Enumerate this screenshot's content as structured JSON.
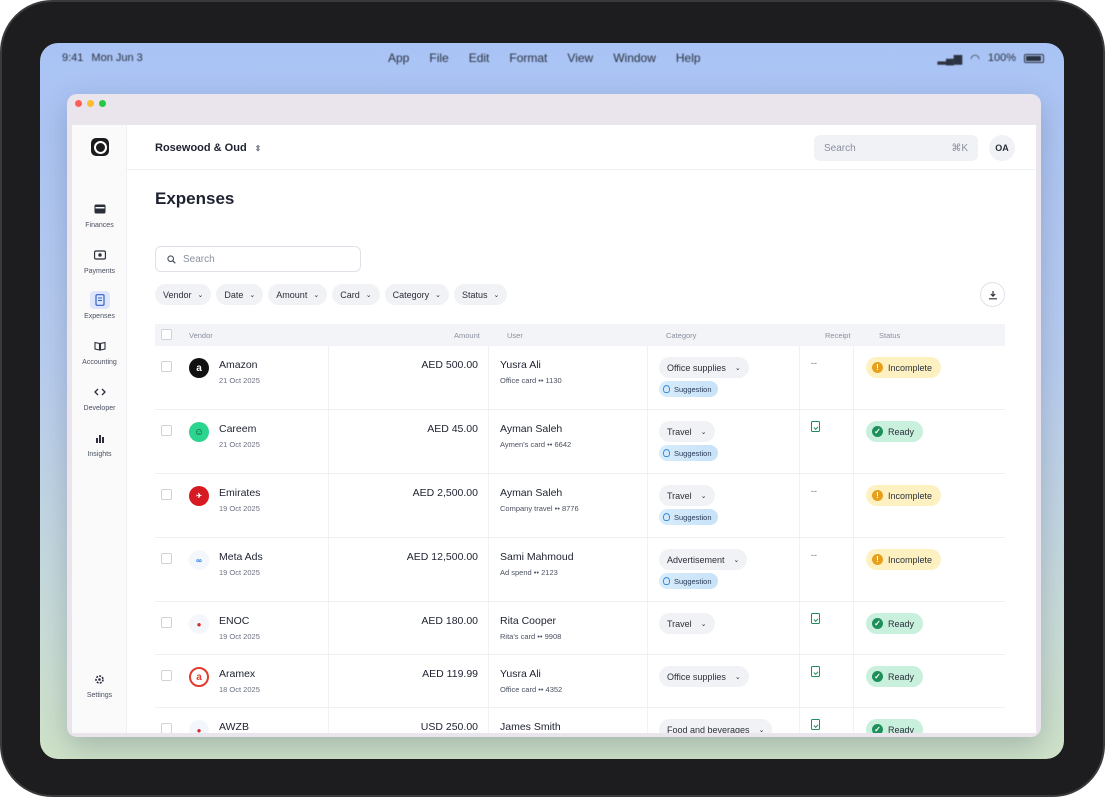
{
  "menubar": {
    "time": "9:41",
    "date": "Mon Jun 3",
    "items": [
      "App",
      "File",
      "Edit",
      "Format",
      "View",
      "Window",
      "Help"
    ],
    "battery": "100%"
  },
  "header": {
    "workspace": "Rosewood & Oud",
    "search_placeholder": "Search",
    "shortcut": "⌘K",
    "avatar_initials": "OA"
  },
  "sidebar": {
    "items": [
      {
        "label": "Finances",
        "icon": "wallet-icon"
      },
      {
        "label": "Payments",
        "icon": "cash-icon"
      },
      {
        "label": "Expenses",
        "icon": "receipt-icon",
        "active": true
      },
      {
        "label": "Accounting",
        "icon": "book-icon"
      },
      {
        "label": "Developer",
        "icon": "code-icon"
      },
      {
        "label": "Insights",
        "icon": "bar-chart-icon"
      }
    ],
    "settings_label": "Settings"
  },
  "page": {
    "title": "Expenses",
    "search_placeholder": "Search",
    "filters": [
      "Vendor",
      "Date",
      "Amount",
      "Card",
      "Category",
      "Status"
    ]
  },
  "table": {
    "columns": {
      "vendor": "Vendor",
      "amount": "Amount",
      "user": "User",
      "category": "Category",
      "receipt": "Receipt",
      "status": "Status"
    },
    "suggestion_label": "Suggestion",
    "rows": [
      {
        "vendor": "Amazon",
        "date": "21 Oct 2025",
        "amount": "AED 500.00",
        "user": "Yusra Ali",
        "card": "Office card •• 1130",
        "category": "Office supplies",
        "suggestion": true,
        "receipt": "--",
        "status": "Incomplete"
      },
      {
        "vendor": "Careem",
        "date": "21 Oct 2025",
        "amount": "AED 45.00",
        "user": "Ayman Saleh",
        "card": "Aymen's card •• 6642",
        "category": "Travel",
        "suggestion": true,
        "receipt": "doc",
        "status": "Ready"
      },
      {
        "vendor": "Emirates",
        "date": "19 Oct 2025",
        "amount": "AED 2,500.00",
        "user": "Ayman Saleh",
        "card": "Company travel •• 8776",
        "category": "Travel",
        "suggestion": true,
        "receipt": "--",
        "status": "Incomplete"
      },
      {
        "vendor": "Meta Ads",
        "date": "19 Oct 2025",
        "amount": "AED 12,500.00",
        "user": "Sami Mahmoud",
        "card": "Ad spend •• 2123",
        "category": "Advertisement",
        "suggestion": true,
        "receipt": "--",
        "status": "Incomplete"
      },
      {
        "vendor": "ENOC",
        "date": "19 Oct 2025",
        "amount": "AED 180.00",
        "user": "Rita Cooper",
        "card": "Rita's card •• 9908",
        "category": "Travel",
        "suggestion": false,
        "receipt": "doc",
        "status": "Ready"
      },
      {
        "vendor": "Aramex",
        "date": "18 Oct 2025",
        "amount": "AED 119.99",
        "user": "Yusra Ali",
        "card": "Office card •• 4352",
        "category": "Office supplies",
        "suggestion": false,
        "receipt": "doc",
        "status": "Ready"
      },
      {
        "vendor": "AWZB",
        "date": "",
        "amount": "USD 250.00",
        "user": "James Smith",
        "card": "",
        "category": "Food and beverages",
        "suggestion": false,
        "receipt": "doc",
        "status": "Ready"
      }
    ]
  },
  "colors": {
    "ready": "#c8f0dc",
    "incomplete": "#fdf1c2",
    "active_nav": "#dde6fb"
  }
}
